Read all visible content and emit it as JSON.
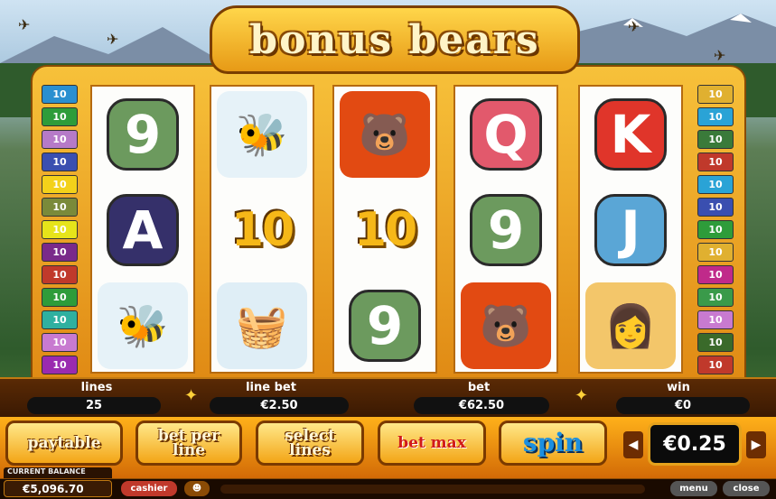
{
  "game": {
    "title": "bonus bears"
  },
  "reels": [
    [
      {
        "symbol": "9",
        "kind": "letter",
        "color": "#6c9a5e"
      },
      {
        "symbol": "A",
        "kind": "letter",
        "color": "#35306a"
      },
      {
        "symbol": "bee-icon",
        "kind": "picture",
        "color": "#e6f2f8"
      }
    ],
    [
      {
        "symbol": "bee-icon",
        "kind": "picture",
        "color": "#e6f2f8"
      },
      {
        "symbol": "10",
        "kind": "ten",
        "color": "#f6b818"
      },
      {
        "symbol": "picnic-basket-icon",
        "kind": "picture",
        "color": "#dfeef6"
      }
    ],
    [
      {
        "symbol": "bear-icon",
        "kind": "picture",
        "color": "#e24a12"
      },
      {
        "symbol": "10",
        "kind": "ten",
        "color": "#f6b818"
      },
      {
        "symbol": "9",
        "kind": "letter",
        "color": "#6c9a5e"
      }
    ],
    [
      {
        "symbol": "Q",
        "kind": "letter",
        "color": "#e2596c"
      },
      {
        "symbol": "9",
        "kind": "letter",
        "color": "#6c9a5e"
      },
      {
        "symbol": "bear-icon",
        "kind": "picture",
        "color": "#e24a12"
      }
    ],
    [
      {
        "symbol": "K",
        "kind": "letter",
        "color": "#e0352a"
      },
      {
        "symbol": "J",
        "kind": "letter",
        "color": "#5aa6d6"
      },
      {
        "symbol": "ranger-girl-icon",
        "kind": "picture",
        "color": "#f3c66a"
      }
    ]
  ],
  "paylines_left": [
    {
      "label": "10",
      "color": "#2a8fd0"
    },
    {
      "label": "10",
      "color": "#2e9c3a"
    },
    {
      "label": "10",
      "color": "#b67ac8"
    },
    {
      "label": "10",
      "color": "#3a4fb0"
    },
    {
      "label": "10",
      "color": "#f3d11a"
    },
    {
      "label": "10",
      "color": "#7a8a3a"
    },
    {
      "label": "10",
      "color": "#e6e41a"
    },
    {
      "label": "10",
      "color": "#7a2a8a"
    },
    {
      "label": "10",
      "color": "#c0392b"
    },
    {
      "label": "10",
      "color": "#2e9c3a"
    },
    {
      "label": "10",
      "color": "#2fb0a0"
    },
    {
      "label": "10",
      "color": "#c87ad0"
    },
    {
      "label": "10",
      "color": "#9a2ab0"
    }
  ],
  "paylines_right": [
    {
      "label": "10",
      "color": "#e0b030"
    },
    {
      "label": "10",
      "color": "#2aa3d6"
    },
    {
      "label": "10",
      "color": "#3a7a3a"
    },
    {
      "label": "10",
      "color": "#c0392b"
    },
    {
      "label": "10",
      "color": "#2aa3d6"
    },
    {
      "label": "10",
      "color": "#3a4fb0"
    },
    {
      "label": "10",
      "color": "#2e9c3a"
    },
    {
      "label": "10",
      "color": "#e0b030"
    },
    {
      "label": "10",
      "color": "#c02a8a"
    },
    {
      "label": "10",
      "color": "#3a9a4a"
    },
    {
      "label": "10",
      "color": "#c87ad0"
    },
    {
      "label": "10",
      "color": "#3a6a2a"
    },
    {
      "label": "10",
      "color": "#c0392b"
    }
  ],
  "info": {
    "lines_label": "lines",
    "lines_value": "25",
    "line_bet_label": "line bet",
    "line_bet_value": "€2.50",
    "bet_label": "bet",
    "bet_value": "€62.50",
    "win_label": "win",
    "win_value": "€0"
  },
  "buttons": {
    "paytable": "paytable",
    "bet_per_line": "bet per line",
    "select_lines": "select lines",
    "bet_max": "bet max",
    "spin": "spin",
    "coin_value": "€0.25"
  },
  "status": {
    "balance_label": "CURRENT BALANCE",
    "balance_value": "€5,096.70",
    "cashier": "cashier",
    "menu": "menu",
    "close": "close"
  },
  "colors": {
    "frame": "#f2a821",
    "accent": "#7a3a00",
    "spin_text": "#1b8fe0",
    "bet_max_text": "#d11a1a"
  }
}
